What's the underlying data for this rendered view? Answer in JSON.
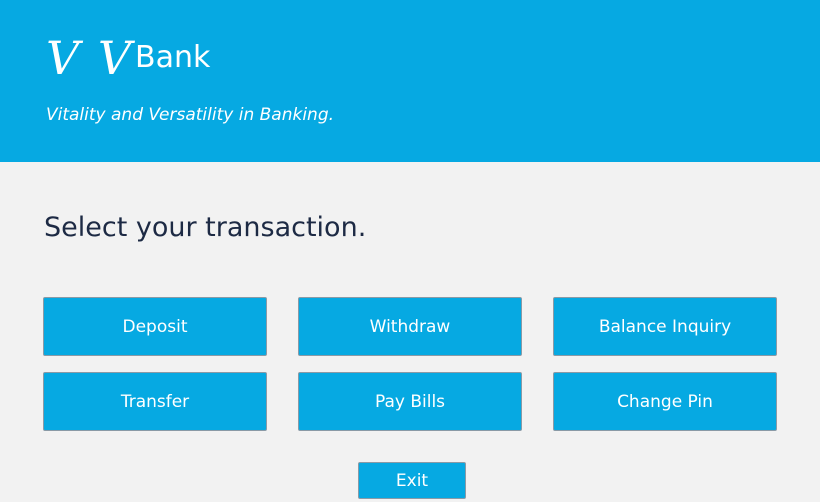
{
  "header": {
    "logo_vv": "V V",
    "logo_bank": "Bank",
    "tagline": "Vitality and Versatility in Banking."
  },
  "main": {
    "prompt": "Select your transaction."
  },
  "buttons": {
    "deposit": "Deposit",
    "withdraw": "Withdraw",
    "balance_inquiry": "Balance Inquiry",
    "transfer": "Transfer",
    "pay_bills": "Pay Bills",
    "change_pin": "Change Pin",
    "exit": "Exit"
  },
  "colors": {
    "accent": "#06a9e2",
    "background": "#f2f2f2",
    "prompt_text": "#1d2a44",
    "button_border": "#8a9aa6"
  }
}
